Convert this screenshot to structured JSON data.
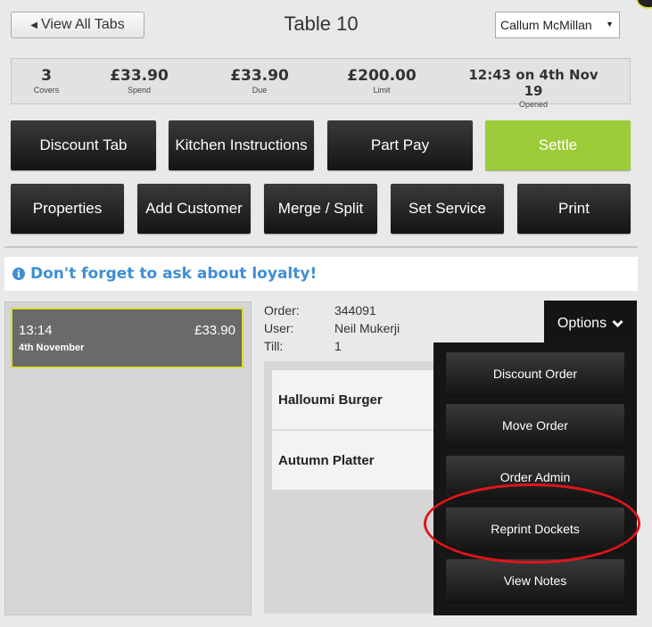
{
  "header": {
    "back_label": "View All Tabs",
    "title": "Table 10",
    "staff_selected": "Callum McMillan"
  },
  "stats": [
    {
      "value": "3",
      "label": "Covers"
    },
    {
      "value": "£33.90",
      "label": "Spend"
    },
    {
      "value": "£33.90",
      "label": "Due"
    },
    {
      "value": "£200.00",
      "label": "Limit"
    },
    {
      "value": "12:43 on 4th Nov 19",
      "label": "Opened"
    }
  ],
  "actions_row1": [
    "Discount Tab",
    "Kitchen Instructions",
    "Part Pay",
    "Settle"
  ],
  "actions_row2": [
    "Properties",
    "Add Customer",
    "Merge / Split",
    "Set Service",
    "Print"
  ],
  "notice": {
    "icon": "info-icon",
    "text": "Don't forget to ask about loyalty!",
    "color": "#3f8ed5"
  },
  "orders": [
    {
      "time": "13:14",
      "amount": "£33.90",
      "date": "4th November"
    }
  ],
  "order_details": {
    "order_label": "Order:",
    "order_value": "344091",
    "user_label": "User:",
    "user_value": "Neil Mukerji",
    "till_label": "Till:",
    "till_value": "1"
  },
  "items": [
    "Halloumi Burger",
    "Autumn Platter"
  ],
  "options": {
    "label": "Options",
    "items": [
      "Discount Order",
      "Move Order",
      "Order Admin",
      "Reprint Dockets",
      "View Notes"
    ]
  },
  "colors": {
    "settle": "#9bcb38",
    "highlight": "#e0141b",
    "selected_border": "#d9dc32"
  }
}
